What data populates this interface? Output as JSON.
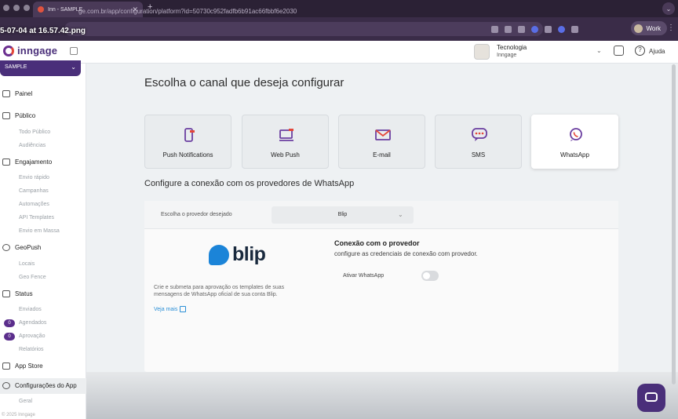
{
  "browser": {
    "tab_title": "Inn - SAMPLE",
    "url": "ge.com.br/app/configuration/platform?id=50730c952fadfb6b91ac66fbbf6e2030",
    "screenshot_filename": "5-07-04 at 16.57.42.png",
    "profile_label": "Work"
  },
  "header": {
    "logo_text": "inngage",
    "user_name": "Tecnologia",
    "user_org": "Inngage",
    "help_label": "Ajuda"
  },
  "sidebar": {
    "workspace": "SAMPLE",
    "sections": [
      {
        "label": "Painel",
        "icon": "monitor-icon"
      },
      {
        "label": "Público",
        "icon": "users-icon"
      },
      {
        "label": "Engajamento",
        "icon": "chat-icon"
      },
      {
        "label": "GeoPush",
        "icon": "location-pin-icon"
      },
      {
        "label": "Status",
        "icon": "list-icon"
      },
      {
        "label": "App Store",
        "icon": "apps-icon"
      },
      {
        "label": "Configurações do App",
        "icon": "gear-icon"
      }
    ],
    "publico_items": [
      "Todo Público",
      "Audiências"
    ],
    "engajamento_items": [
      "Envio rápido",
      "Campanhas",
      "Automações",
      "API Templates",
      "Envio em Massa"
    ],
    "geopush_items": [
      "Locais",
      "Geo Fence"
    ],
    "status_items": [
      "Enviados",
      "Agendados",
      "Aprovação",
      "Relatórios"
    ],
    "status_badges": {
      "agendados": "0",
      "aprovacao": "0"
    },
    "config_items": [
      "Geral"
    ],
    "footer": "© 2025 Inngage"
  },
  "main": {
    "title": "Escolha o canal que deseja configurar",
    "channels": [
      {
        "label": "Push Notifications",
        "icon": "mobile-push-icon",
        "active": false
      },
      {
        "label": "Web Push",
        "icon": "web-push-icon",
        "active": false
      },
      {
        "label": "E-mail",
        "icon": "envelope-icon",
        "active": false
      },
      {
        "label": "SMS",
        "icon": "sms-bubble-icon",
        "active": false
      },
      {
        "label": "WhatsApp",
        "icon": "whatsapp-icon",
        "active": true
      }
    ],
    "section_title": "Configure a conexão com os provedores de WhatsApp",
    "provider_label": "Escolha o provedor desejado",
    "provider_value": "Blip",
    "blip_logo_text": "blip",
    "blip_description": "Crie e submeta para aprovação os templates de suas mensagens de WhatsApp oficial de sua conta Blip.",
    "more_link": "Veja mais",
    "connection_title": "Conexão com o provedor",
    "connection_desc": "configure as credenciais de conexão com provedor.",
    "toggle_label": "Ativar WhatsApp",
    "toggle_on": false
  },
  "colors": {
    "brand": "#4a2f7a",
    "accent": "#e4473a",
    "channel_icon": "#6b3fa0",
    "blip": "#1b84d8"
  }
}
